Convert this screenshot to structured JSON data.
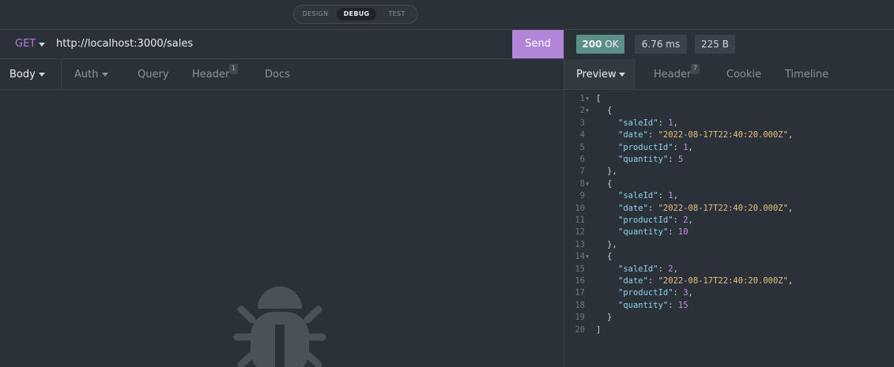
{
  "modes": [
    "DESIGN",
    "DEBUG",
    "TEST"
  ],
  "active_mode": "DEBUG",
  "request": {
    "method": "GET",
    "url": "http://localhost:3000/sales",
    "send_label": "Send",
    "tabs": [
      {
        "label": "Body"
      },
      {
        "label": "Auth"
      },
      {
        "label": "Query"
      },
      {
        "label": "Header",
        "badge": "1"
      },
      {
        "label": "Docs"
      }
    ]
  },
  "response": {
    "status_code": "200",
    "status_text": "OK",
    "time": "6.76 ms",
    "size": "225 B",
    "tabs": [
      {
        "label": "Preview"
      },
      {
        "label": "Header",
        "badge": "7"
      },
      {
        "label": "Cookie"
      },
      {
        "label": "Timeline"
      }
    ],
    "lines": [
      {
        "n": "1",
        "fold": true,
        "indent": 0,
        "text": "["
      },
      {
        "n": "2",
        "fold": true,
        "indent": 1,
        "text": "{"
      },
      {
        "n": "3",
        "indent": 2,
        "key": "\"saleId\"",
        "value": "1",
        "type": "num",
        "comma": true
      },
      {
        "n": "4",
        "indent": 2,
        "key": "\"date\"",
        "value": "\"2022-08-17T22:40:20.000Z\"",
        "type": "str",
        "comma": true
      },
      {
        "n": "5",
        "indent": 2,
        "key": "\"productId\"",
        "value": "1",
        "type": "num",
        "comma": true
      },
      {
        "n": "6",
        "indent": 2,
        "key": "\"quantity\"",
        "value": "5",
        "type": "num",
        "comma": false
      },
      {
        "n": "7",
        "indent": 1,
        "text": "},"
      },
      {
        "n": "8",
        "fold": true,
        "indent": 1,
        "text": "{"
      },
      {
        "n": "9",
        "indent": 2,
        "key": "\"saleId\"",
        "value": "1",
        "type": "num",
        "comma": true
      },
      {
        "n": "10",
        "indent": 2,
        "key": "\"date\"",
        "value": "\"2022-08-17T22:40:20.000Z\"",
        "type": "str",
        "comma": true
      },
      {
        "n": "11",
        "indent": 2,
        "key": "\"productId\"",
        "value": "2",
        "type": "num",
        "comma": true
      },
      {
        "n": "12",
        "indent": 2,
        "key": "\"quantity\"",
        "value": "10",
        "type": "num",
        "comma": false
      },
      {
        "n": "13",
        "indent": 1,
        "text": "},"
      },
      {
        "n": "14",
        "fold": true,
        "indent": 1,
        "text": "{"
      },
      {
        "n": "15",
        "indent": 2,
        "key": "\"saleId\"",
        "value": "2",
        "type": "num",
        "comma": true
      },
      {
        "n": "16",
        "indent": 2,
        "key": "\"date\"",
        "value": "\"2022-08-17T22:40:20.000Z\"",
        "type": "str",
        "comma": true
      },
      {
        "n": "17",
        "indent": 2,
        "key": "\"productId\"",
        "value": "3",
        "type": "num",
        "comma": true
      },
      {
        "n": "18",
        "indent": 2,
        "key": "\"quantity\"",
        "value": "15",
        "type": "num",
        "comma": false
      },
      {
        "n": "19",
        "indent": 1,
        "text": "}"
      },
      {
        "n": "20",
        "indent": 0,
        "text": "]"
      }
    ]
  },
  "icons": [
    "chevron-down-icon",
    "bug-icon",
    "fold-arrow-icon"
  ],
  "colors": {
    "background": "#2b3138",
    "accent": "#b285d8",
    "method": "#b57ad6",
    "status_ok": "#5d8f8a",
    "json_key": "#8fd3e8",
    "json_string": "#e5c07b",
    "json_number": "#c78fe0"
  }
}
